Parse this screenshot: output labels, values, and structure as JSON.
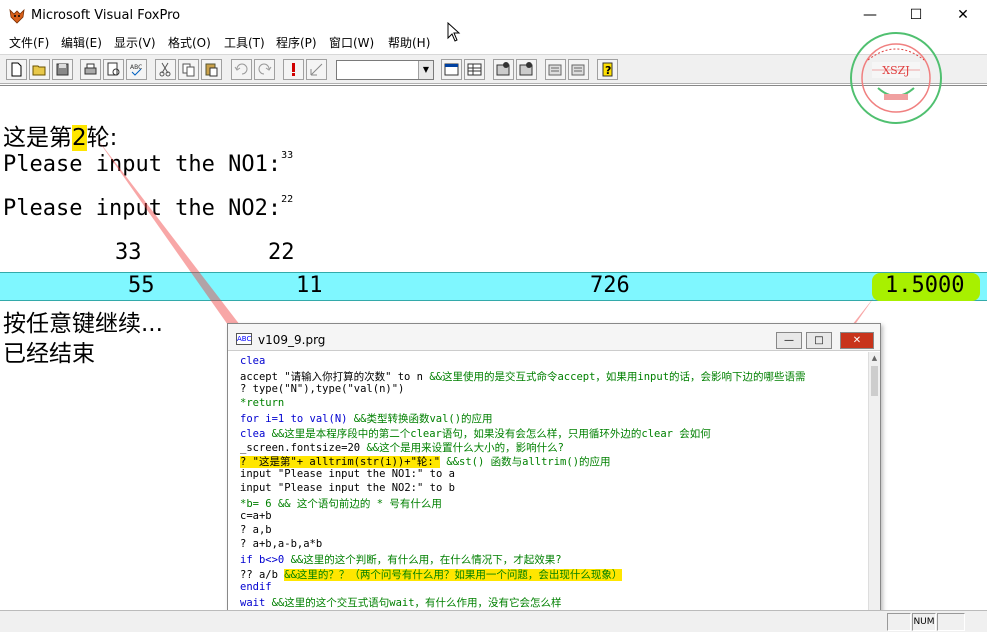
{
  "window": {
    "title": "Microsoft Visual FoxPro",
    "min_glyph": "—",
    "max_glyph": "☐",
    "close_glyph": "✕"
  },
  "menu": [
    "文件(F)",
    "编辑(E)",
    "显示(V)",
    "格式(O)",
    "工具(T)",
    "程序(P)",
    "窗口(W)",
    "帮助(H)"
  ],
  "toolbar": {
    "icons": [
      "new-file-icon",
      "open-folder-icon",
      "save-icon",
      "print-icon",
      "print-preview-icon",
      "spell-check-icon",
      "cut-icon",
      "copy-icon",
      "paste-icon",
      "undo-icon",
      "redo-icon",
      "run-icon",
      "modify-form-icon",
      "command-window-icon",
      "data-session-icon",
      "form-designer-icon",
      "report-designer-icon",
      "builder-icon",
      "wizard-icon",
      "help-icon"
    ],
    "combo_value": ""
  },
  "output": {
    "round_prefix": "这是第",
    "round_num": "2",
    "round_suffix": "轮:",
    "prompt1": "Please input the NO1:",
    "prompt1_val": "33",
    "prompt2": "Please input the NO2:",
    "prompt2_val": "22",
    "a": "33",
    "b": "22",
    "sum": "55",
    "diff": "11",
    "prod": "726",
    "quot": "1.5000",
    "press_key": "按任意键继续...",
    "ended": "已经结束"
  },
  "stamp": {
    "code": "XSZJ"
  },
  "code_window": {
    "title": "v109_9.prg",
    "min_glyph": "—",
    "max_glyph": "□",
    "close_glyph": "✕",
    "lines": [
      {
        "code": "clea",
        "comment": ""
      },
      {
        "code": "accept \"请输入你打算的次数\" to n",
        "comment": "&&这里使用的是交互式命令accept，如果用input的话，会影响下边的哪些语需"
      },
      {
        "code": "? type(\"N\"),type(\"val(n)\")",
        "comment": ""
      },
      {
        "code": "*return",
        "comment": ""
      },
      {
        "code": "for i=1 to val(N)",
        "comment": "&&类型转换函数val()的应用"
      },
      {
        "code": "clea",
        "comment": "&&这里是本程序段中的第二个clear语句，如果没有会怎么样，只用循环外边的clear 会如何"
      },
      {
        "code": "_screen.fontsize=20",
        "comment": "&&这个是用来设置什么大小的，影响什么?"
      },
      {
        "code": "? \"这是第\"+ alltrim(str(i))+\"轮:\"",
        "comment": "&&st() 函数与alltrim()的应用"
      },
      {
        "code": "input \"Please input the NO1:\" to a",
        "comment": ""
      },
      {
        "code": "input \"Please input the NO2:\" to b",
        "comment": ""
      },
      {
        "code": "*b= 6",
        "comment": "&& 这个语句前边的 * 号有什么用"
      },
      {
        "code": "c=a+b",
        "comment": ""
      },
      {
        "code": "? a,b",
        "comment": ""
      },
      {
        "code": "? a+b,a-b,a*b",
        "comment": ""
      },
      {
        "code": "if b<>0",
        "comment": "&&这里的这个判断，有什么用，在什么情况下，才起效果?"
      },
      {
        "code": "    ?? a/b",
        "comment": "&&这里的？？（两个问号有什么用？如果用一个问题，会出现什么现象）"
      },
      {
        "code": "endif",
        "comment": ""
      },
      {
        "code": "wait",
        "comment": "&&这里的这个交互式语句wait，有什么作用，没有它会怎么样"
      }
    ]
  },
  "statusbar": {
    "num": "NUM"
  }
}
